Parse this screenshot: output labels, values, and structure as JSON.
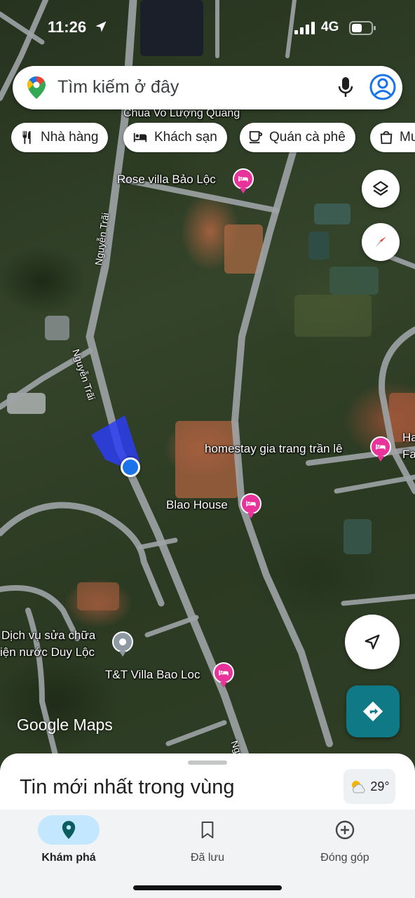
{
  "status_bar": {
    "time": "11:26",
    "network": "4G"
  },
  "search": {
    "placeholder": "Tìm kiếm ở đây"
  },
  "chips": [
    {
      "label": "Nhà hàng",
      "icon": "restaurant-icon"
    },
    {
      "label": "Khách sạn",
      "icon": "hotel-icon"
    },
    {
      "label": "Quán cà phê",
      "icon": "coffee-icon"
    },
    {
      "label": "Mu",
      "icon": "shopping-bag-icon"
    }
  ],
  "map": {
    "places": {
      "chua": "Chua Vo Lượng Quang",
      "rose_villa": "Rose villa Bảo Lộc",
      "homestay": "homestay gia trang trần lê",
      "blao_house": "Blao House",
      "tt_villa": "T&T Villa Bao Loc",
      "dich_vu_1": "Dịch vụ sửa chữa",
      "dich_vu_2": "iện nước Duy Lộc",
      "edge_1": "Ha",
      "edge_2": "Fa"
    },
    "roads": {
      "nguyen_trai_1": "Nguyễn Trãi",
      "nguyen_trai_2": "Nguyễn Trãi",
      "nguyen_trai_3": "Ngu"
    },
    "attribution": "Google Maps"
  },
  "sheet": {
    "title": "Tin mới nhất trong vùng",
    "temperature": "29°"
  },
  "nav": [
    {
      "label": "Khám phá",
      "icon": "explore-pin-icon",
      "active": true
    },
    {
      "label": "Đã lưu",
      "icon": "bookmark-icon",
      "active": false
    },
    {
      "label": "Đóng góp",
      "icon": "add-circle-icon",
      "active": false
    }
  ],
  "colors": {
    "hotel_pin": "#e8339b",
    "location_dot": "#1a73e8",
    "directions_button": "#0f7a85",
    "nav_active": "#c2e7ff"
  }
}
